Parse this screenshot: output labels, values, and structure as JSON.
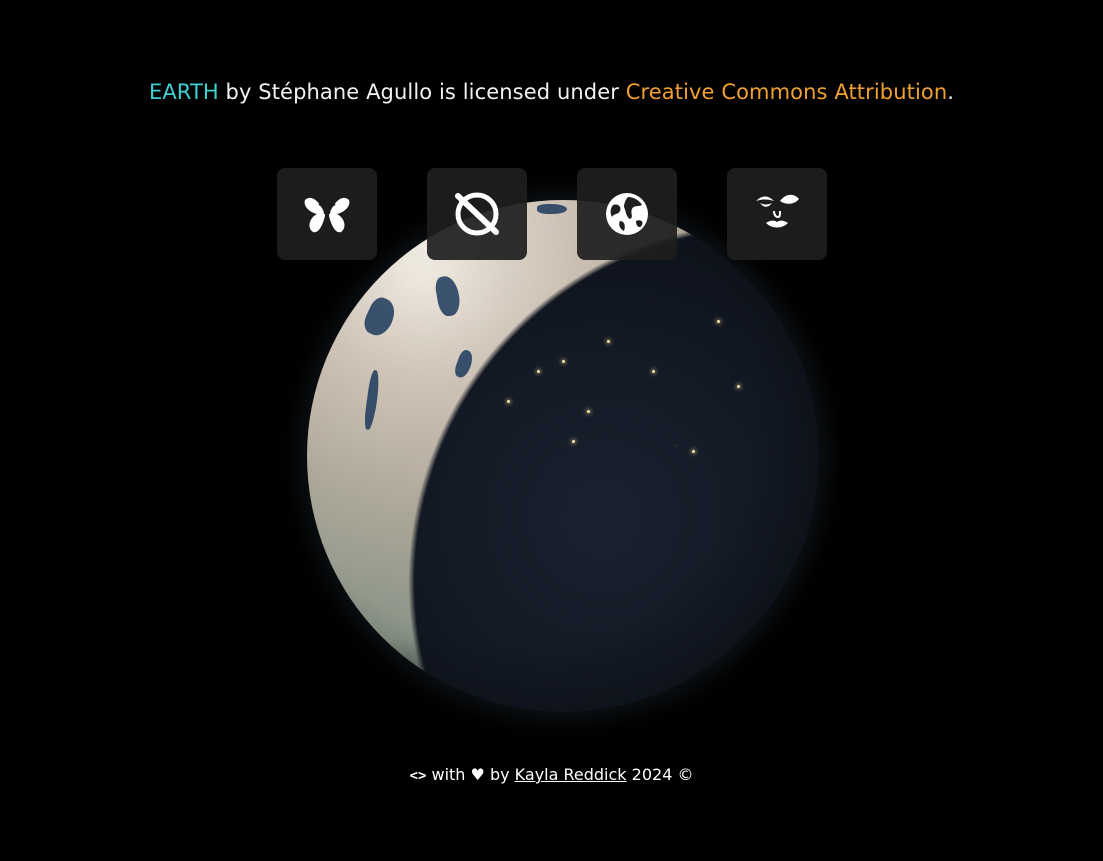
{
  "attribution": {
    "title": "EARTH",
    "by_text": " by Stéphane Agullo is licensed under ",
    "license": "Creative Commons Attribution",
    "period": "."
  },
  "icons": [
    {
      "name": "butterfly-icon"
    },
    {
      "name": "no-planet-icon"
    },
    {
      "name": "earth-globe-icon"
    },
    {
      "name": "face-icon"
    }
  ],
  "footer": {
    "code_symbol": "<>",
    "with_text": " with ",
    "heart": "♥",
    "by_text": " by ",
    "author": "Kayla Reddick",
    "year_text": " 2024 ©"
  },
  "colors": {
    "background": "#000000",
    "title_accent": "#3fd0d4",
    "license_accent": "#f0a030",
    "button_bg": "#1e1e1e"
  }
}
